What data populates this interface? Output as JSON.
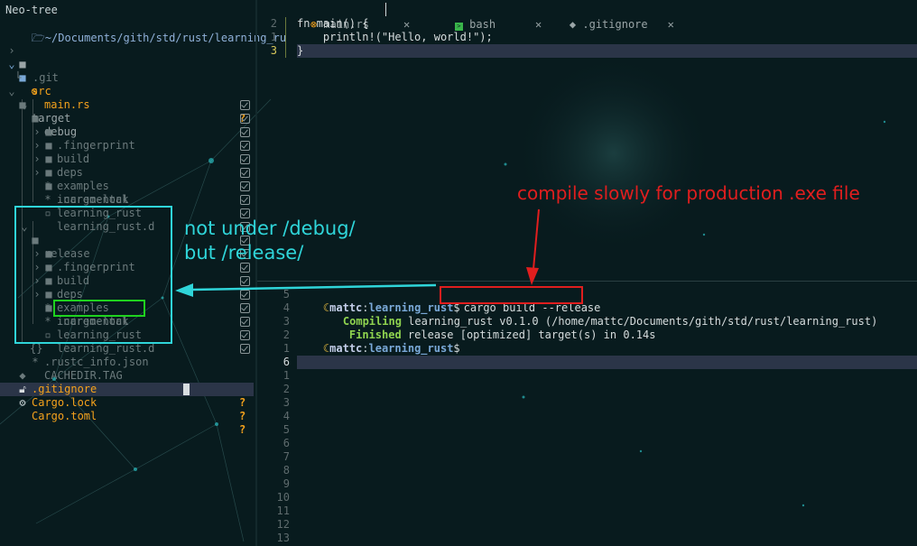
{
  "colors": {
    "background": "#081b1e",
    "accent_cyan": "#2fd5d9",
    "accent_red": "#e01e1e",
    "accent_green": "#1fd21f",
    "highlight_row": "#2b3548",
    "orange": "#f5a21c"
  },
  "sidebar": {
    "title": "Neo-tree",
    "root_path": "~/Documents/gith/std/rust/learning_ru",
    "items": [
      {
        "name": ".git",
        "icon": "folder-icon",
        "status": ""
      },
      {
        "name": "src",
        "icon": "folder-open-icon",
        "status": ""
      },
      {
        "name": "main.rs",
        "icon": "rust-icon",
        "status": "?"
      },
      {
        "name": "target",
        "icon": "folder-open-icon",
        "status": ""
      },
      {
        "name": "debug",
        "icon": "folder-open-icon",
        "status": ""
      },
      {
        "name": ".fingerprint",
        "icon": "folder-icon",
        "status": "ignored"
      },
      {
        "name": "build",
        "icon": "folder-icon",
        "status": "ignored"
      },
      {
        "name": "deps",
        "icon": "folder-icon",
        "status": "ignored"
      },
      {
        "name": "examples",
        "icon": "folder-icon",
        "status": "ignored"
      },
      {
        "name": "incremental",
        "icon": "folder-icon",
        "status": "ignored"
      },
      {
        "name": ".cargo-lock",
        "icon": "asterisk-icon",
        "status": "ignored"
      },
      {
        "name": "learning_rust",
        "icon": "asterisk-icon",
        "status": "ignored"
      },
      {
        "name": "learning_rust.d",
        "icon": "file-icon",
        "status": "ignored"
      },
      {
        "name": "release",
        "icon": "folder-open-icon",
        "status": "ignored"
      },
      {
        "name": ".fingerprint",
        "icon": "folder-icon",
        "status": "ignored"
      },
      {
        "name": "build",
        "icon": "folder-icon",
        "status": "ignored"
      },
      {
        "name": "deps",
        "icon": "folder-icon",
        "status": "ignored"
      },
      {
        "name": "examples",
        "icon": "folder-icon",
        "status": "ignored"
      },
      {
        "name": "incremental",
        "icon": "folder-icon",
        "status": "ignored"
      },
      {
        "name": ".cargo-lock",
        "icon": "asterisk-icon",
        "status": "ignored"
      },
      {
        "name": "learning_rust",
        "icon": "asterisk-icon",
        "status": "ignored"
      },
      {
        "name": "learning_rust.d",
        "icon": "file-icon",
        "status": "ignored"
      },
      {
        "name": ".rustc_info.json",
        "icon": "json-icon",
        "status": "ignored"
      },
      {
        "name": "CACHEDIR.TAG",
        "icon": "asterisk-icon",
        "status": "ignored"
      },
      {
        "name": ".gitignore",
        "icon": "git-icon",
        "status": "?"
      },
      {
        "name": "Cargo.lock",
        "icon": "lock-icon",
        "status": "?"
      },
      {
        "name": "Cargo.toml",
        "icon": "gear-icon",
        "status": "?"
      }
    ]
  },
  "tabs": [
    {
      "label": "main.rs",
      "icon": "rust-icon",
      "close": "✕"
    },
    {
      "label": "bash",
      "icon": "terminal-icon",
      "close": "✕"
    },
    {
      "label": ".gitignore",
      "icon": "git-icon",
      "close": "✕"
    }
  ],
  "editor": {
    "lines": [
      {
        "num": "2",
        "code": "fn main() {"
      },
      {
        "num": "1",
        "code": "    println!(\"Hello, world!\");"
      },
      {
        "num": "3",
        "code": "}"
      }
    ]
  },
  "terminal": {
    "line_numbers": [
      "5",
      "4",
      "3",
      "2",
      "1",
      "6",
      "1",
      "2",
      "3",
      "4",
      "5",
      "6",
      "7",
      "8",
      "9",
      "10",
      "11",
      "12",
      "13"
    ],
    "prompt_user": "mattc",
    "prompt_dir": "learning_rust",
    "prompt_sym": "$",
    "command": "cargo build --release",
    "out_compiling_label": "Compiling",
    "out_compiling_text": " learning_rust v0.1.0 (/home/mattc/Documents/gith/std/rust/learning_rust)",
    "out_finished_label": "Finished",
    "out_finished_text": " release [optimized] target(s) in 0.14s"
  },
  "annotations": {
    "cyan_line1": "not under /debug/",
    "cyan_line2": "but /release/",
    "red_note": "compile slowly for production .exe file"
  }
}
